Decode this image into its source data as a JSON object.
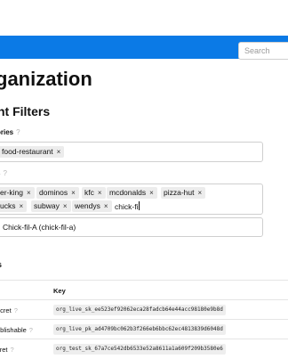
{
  "header": {
    "search_placeholder": "Search"
  },
  "page": {
    "title": "ganization",
    "filters_title": "nt Filters"
  },
  "categories": {
    "label": "ories",
    "help": "?",
    "chips": [
      "food-restaurant"
    ]
  },
  "brands": {
    "label": "s",
    "help": "?",
    "chips_row1": [
      "er-king",
      "dominos",
      "kfc",
      "mcdonalds",
      "pizza-hut"
    ],
    "chips_row2": [
      "ucks",
      "subway",
      "wendys"
    ],
    "input_value": "chick-fi",
    "suggestion": "Chick-fil-A (chick-fil-a)"
  },
  "api_keys": {
    "heading": "s",
    "columns": {
      "name": "",
      "key": "Key"
    },
    "rows": [
      {
        "name": "ecret",
        "help": "?",
        "key": "org_live_sk_ee523ef92062eca28fadcb64e44acc98180e9b8d"
      },
      {
        "name": "ublishable",
        "help": "?",
        "key": "org_live_pk_ad4709bc062b3f266eb6bbc62ec4813839d6048d"
      },
      {
        "name": "cret",
        "help": "?",
        "key": "org_test_sk_67a7ce542db6533e52a8611a1a609f209b3580e6"
      }
    ]
  },
  "colors": {
    "accent": "#0b7ae6",
    "chip_bg": "#ececec",
    "border": "#cfcfcf"
  }
}
